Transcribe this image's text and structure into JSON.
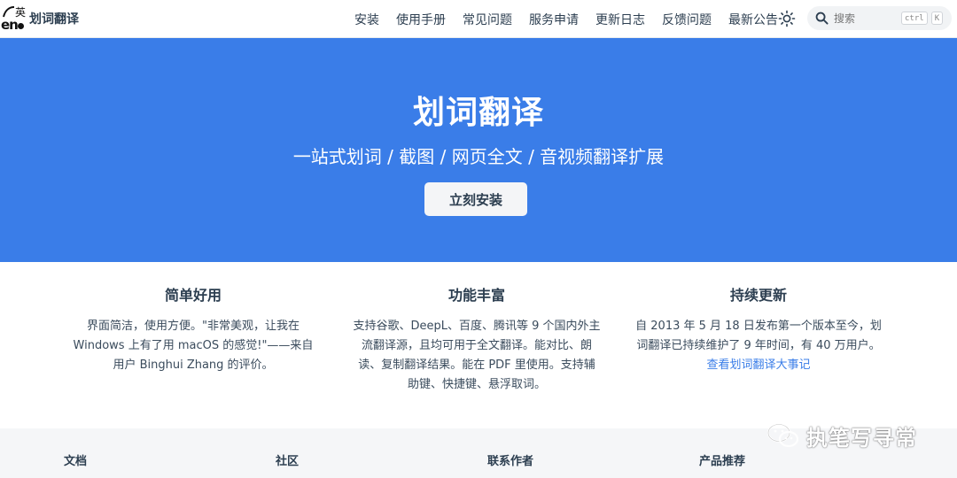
{
  "brand": {
    "logo_text_en": "en",
    "logo_text_cn": "英",
    "title": "划词翻译"
  },
  "nav": {
    "links": [
      "安装",
      "使用手册",
      "常见问题",
      "服务申请",
      "更新日志",
      "反馈问题",
      "最新公告"
    ],
    "theme_icon": "sun-icon"
  },
  "search": {
    "placeholder": "搜索",
    "kbd_1": "ctrl",
    "kbd_2": "K",
    "icon": "search-icon"
  },
  "hero": {
    "title": "划词翻译",
    "subtitle": "一站式划词 / 截图 / 网页全文 / 音视频翻译扩展",
    "cta_label": "立刻安装",
    "background": "#3a7de8"
  },
  "features": [
    {
      "title": "简单好用",
      "body": "界面简洁，使用方便。\"非常美观，让我在 Windows 上有了用 macOS 的感觉!\"——来自用户 Binghui Zhang 的评价。"
    },
    {
      "title": "功能丰富",
      "body": "支持谷歌、DeepL、百度、腾讯等 9 个国内外主流翻译源，且均可用于全文翻译。能对比、朗读、复制翻译结果。能在 PDF 里使用。支持辅助键、快捷键、悬浮取词。"
    },
    {
      "title": "持续更新",
      "body": "自 2013 年 5 月 18 日发布第一个版本至今，划词翻译已持续维护了 9 年时间，有 40 万用户。",
      "link": "查看划词翻译大事记"
    }
  ],
  "footer": {
    "columns": [
      "文档",
      "社区",
      "联系作者",
      "产品推荐"
    ]
  },
  "watermark": {
    "text": "执笔写寻常",
    "icon": "wechat-icon"
  },
  "colors": {
    "accent": "#3a7de8",
    "text": "#2c3e50",
    "footer_bg": "#f5f6f8"
  }
}
